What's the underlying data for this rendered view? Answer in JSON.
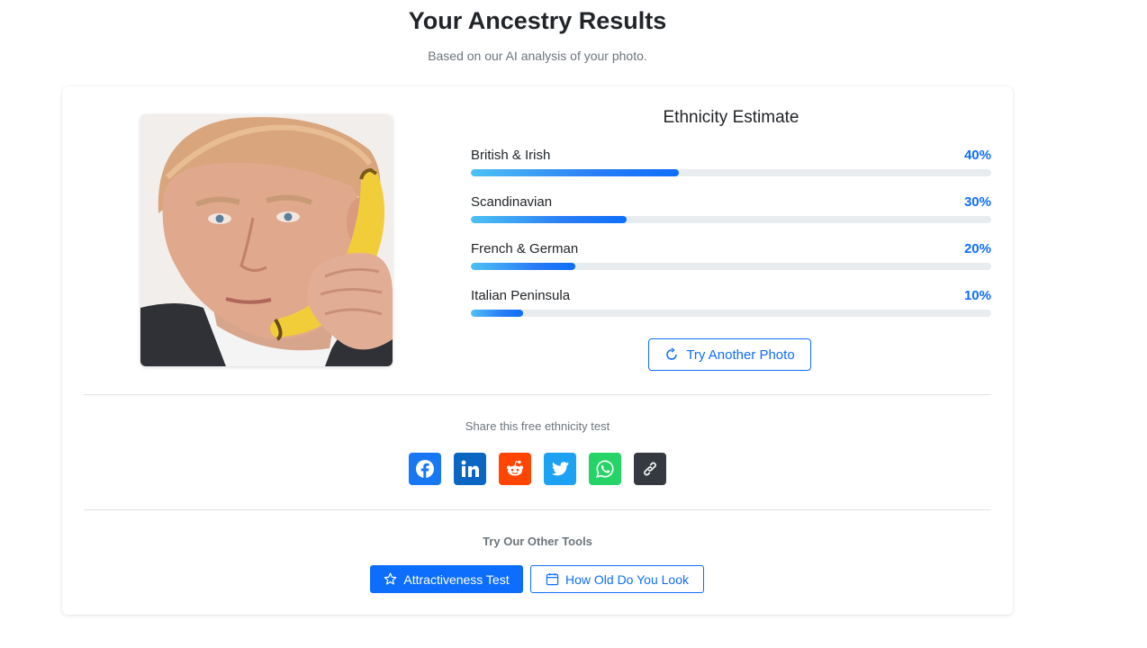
{
  "header": {
    "title": "Your Ancestry Results",
    "subtitle": "Based on our AI analysis of your photo."
  },
  "estimate": {
    "title": "Ethnicity Estimate",
    "items": [
      {
        "label": "British & Irish",
        "value_text": "40%",
        "percent": 40
      },
      {
        "label": "Scandinavian",
        "value_text": "30%",
        "percent": 30
      },
      {
        "label": "French & German",
        "value_text": "20%",
        "percent": 20
      },
      {
        "label": "Italian Peninsula",
        "value_text": "10%",
        "percent": 10
      }
    ],
    "retry_label": "Try Another Photo"
  },
  "share": {
    "text": "Share this free ethnicity test",
    "buttons": [
      {
        "name": "facebook-icon",
        "color": "#1877f2"
      },
      {
        "name": "linkedin-icon",
        "color": "#0a66c2"
      },
      {
        "name": "reddit-icon",
        "color": "#ff4500"
      },
      {
        "name": "twitter-icon",
        "color": "#1da1f2"
      },
      {
        "name": "whatsapp-icon",
        "color": "#25d366"
      },
      {
        "name": "link-icon",
        "color": "#343a40"
      }
    ]
  },
  "tools": {
    "title": "Try Our Other Tools",
    "attractiveness_label": "Attractiveness Test",
    "age_label": "How Old Do You Look"
  },
  "colors": {
    "accent": "#0d6efd",
    "muted_text": "#6c757d",
    "track": "#e9ecef"
  }
}
